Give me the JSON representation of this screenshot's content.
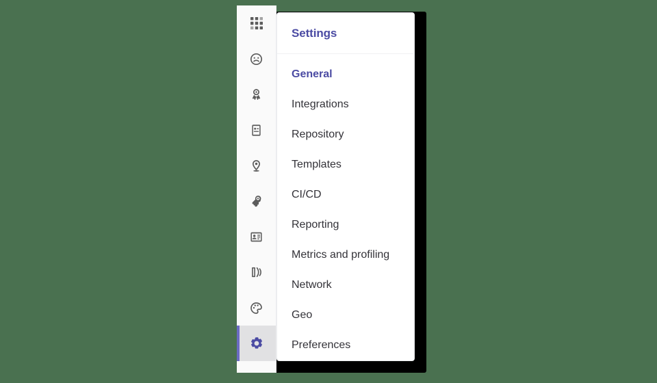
{
  "theme": {
    "background": "#4a7150",
    "accent_purple": "#4b4ba3",
    "active_bar": "#6b6bc4",
    "rail_background": "#fafafa",
    "active_item_background": "#e1e1e3",
    "panel_background": "#ffffff",
    "text_color": "#333238"
  },
  "icon_rail": {
    "items": [
      {
        "icon": "grid-dashboard-icon",
        "label": "Overview",
        "active": false
      },
      {
        "icon": "frowning-face-icon",
        "label": "Abuse Reports",
        "active": false
      },
      {
        "icon": "award-ribbon-icon",
        "label": "Badges",
        "active": false
      },
      {
        "icon": "report-document-icon",
        "label": "Reports",
        "active": false
      },
      {
        "icon": "location-pin-icon",
        "label": "Geo",
        "active": false
      },
      {
        "icon": "key-icon",
        "label": "Deploy Keys",
        "active": false
      },
      {
        "icon": "id-card-icon",
        "label": "License",
        "active": false
      },
      {
        "icon": "package-icon",
        "label": "Packages",
        "active": false
      },
      {
        "icon": "palette-icon",
        "label": "Appearance",
        "active": false
      },
      {
        "icon": "gear-icon",
        "label": "Settings",
        "active": true
      }
    ]
  },
  "settings_panel": {
    "header": {
      "title": "Settings"
    },
    "menu_items": [
      {
        "label": "General",
        "current": true
      },
      {
        "label": "Integrations",
        "current": false
      },
      {
        "label": "Repository",
        "current": false
      },
      {
        "label": "Templates",
        "current": false
      },
      {
        "label": "CI/CD",
        "current": false
      },
      {
        "label": "Reporting",
        "current": false
      },
      {
        "label": "Metrics and profiling",
        "current": false
      },
      {
        "label": "Network",
        "current": false
      },
      {
        "label": "Geo",
        "current": false
      },
      {
        "label": "Preferences",
        "current": false
      }
    ]
  }
}
